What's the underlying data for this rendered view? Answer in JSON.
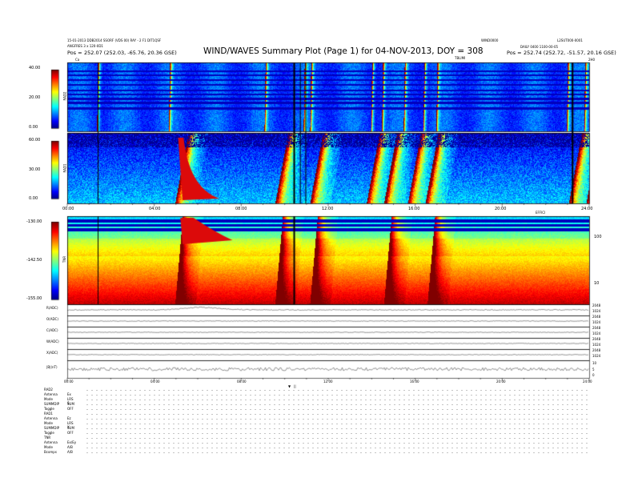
{
  "header": {
    "title": "WIND/WAVES Summary Plot (Page 1) for 04-NOV-2013, DOY = 308",
    "left_line1": "15-01-2013 DDB2014 SSORF (VDS 00) RAY - 2 F1 DIT1QSF",
    "left_line2": "ANGFRES 3 x 120-0D1",
    "left_pos_label": "Pos =",
    "left_pos_value": "252.07 (252.03, -65.76, 20.36 GSE)",
    "right_top": "WIND0000",
    "right_top2": "L2SUT000-0001",
    "right_line2": "DAILY 0400 1100-00-05",
    "right_pos_label": "Pos =",
    "right_pos_value": "252.74 (252.72, -51.57, 20.16 GSE)",
    "marker_left": "Ca",
    "marker_mid": "TBLIMI",
    "marker_right": "2H0"
  },
  "colorbars": [
    {
      "name": "RAD2",
      "ticks": [
        "40.00",
        "20.00",
        "0.00"
      ],
      "ylim": [
        0,
        40
      ]
    },
    {
      "name": "RAD1",
      "ticks": [
        "60.00",
        "30.00",
        "0.00"
      ],
      "ylim": [
        0,
        60
      ]
    },
    {
      "name": "TNR",
      "ticks": [
        "-130.00",
        "-142.50",
        "-155.00"
      ],
      "ylim": [
        -155,
        -130
      ]
    }
  ],
  "tnr_right_axis": {
    "label": "EFFICI",
    "ticks": [
      "100",
      "10"
    ]
  },
  "time_axis": {
    "ticks": [
      "00:00",
      "04:00",
      "08:00",
      "12:00",
      "16:00",
      "20:00",
      "24:00"
    ],
    "xlim": [
      0,
      24
    ]
  },
  "chart_data": [
    {
      "type": "heatmap",
      "name": "RAD2",
      "ylabel": "RAD2",
      "zrange": [
        0,
        40
      ],
      "bursts_hours": [
        1.4,
        4.7,
        9.1,
        10.9,
        11.2,
        14.0,
        14.5,
        15.5,
        16.4,
        17.0,
        23.0,
        23.8
      ],
      "note": "dynamic spectrum, mostly low intensity with horizontal interference bands"
    },
    {
      "type": "heatmap",
      "name": "RAD1",
      "ylabel": "RAD1",
      "zrange": [
        0,
        60
      ],
      "bursts_hours": [
        5.0,
        9.6,
        11.2,
        13.8,
        14.6,
        15.7,
        16.5,
        23.1,
        23.9
      ],
      "note": "strong type III burst near 05:00-06:00"
    },
    {
      "type": "heatmap",
      "name": "TNR",
      "ylabel": "TNR",
      "zrange": [
        -155,
        -130
      ],
      "bursts_hours": [
        5.0,
        9.6,
        11.2,
        14.6,
        16.6
      ]
    },
    {
      "type": "line",
      "x": [
        0,
        24
      ],
      "series": [
        {
          "name": "R(ADC)",
          "right_ticks": [
            "2048",
            "1024"
          ]
        },
        {
          "name": "O(ADC)",
          "right_ticks": [
            "2048",
            "1024"
          ]
        },
        {
          "name": "C(ADC)",
          "right_ticks": [
            "2048",
            "1024"
          ]
        },
        {
          "name": "W(ADC)",
          "right_ticks": [
            "2048",
            "1024"
          ]
        },
        {
          "name": "X(ADC)",
          "right_ticks": [
            "2048",
            "1024"
          ]
        },
        {
          "name": "|B|(nT)",
          "right_ticks": [
            "10",
            "5",
            "0"
          ]
        }
      ]
    }
  ],
  "bottom_markers": [
    "▼",
    "||",
    "▼",
    "||"
  ],
  "summary": {
    "RAD2": [
      {
        "k": "RAD2",
        "v": ""
      },
      {
        "k": "Antenna",
        "v": "Ex"
      },
      {
        "k": "Mode",
        "v": "LRS S"
      },
      {
        "k": "SUMMDIP",
        "v": "SUM"
      },
      {
        "k": "Toggle",
        "v": "OFF"
      }
    ],
    "RAD1": [
      {
        "k": "RAD1",
        "v": ""
      },
      {
        "k": "Antenna",
        "v": "Ez"
      },
      {
        "k": "Mode",
        "v": "LRS X"
      },
      {
        "k": "SUMMDIP",
        "v": "SUM"
      },
      {
        "k": "Toggle",
        "v": "OFF"
      }
    ],
    "TNR": [
      {
        "k": "TNR",
        "v": ""
      },
      {
        "k": "Antenna",
        "v": "Ex/Ey"
      },
      {
        "k": "Mode",
        "v": "A/B"
      },
      {
        "k": "Bcomps",
        "v": "A/B"
      }
    ]
  }
}
